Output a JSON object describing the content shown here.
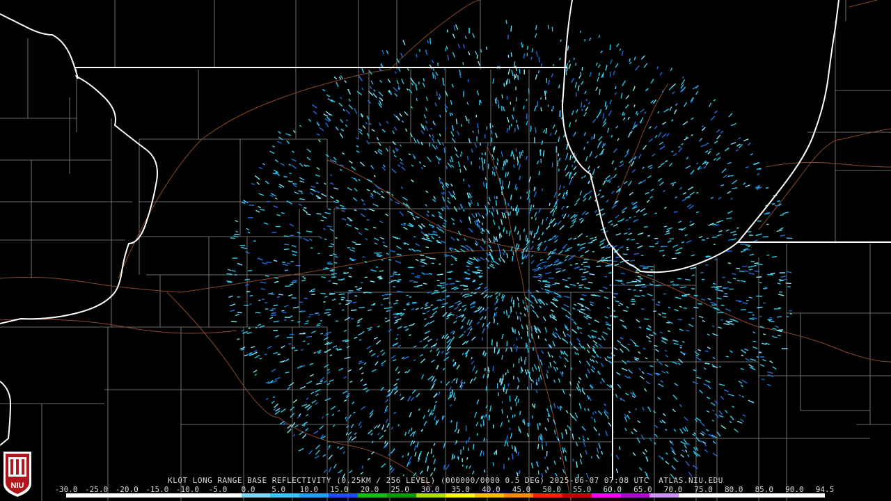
{
  "caption": "KLOT LONG RANGE BASE REFLECTIVITY (0.25KM / 256 LEVEL) (000000/0000 0.5 DEG) 2025-06-07 07:08 UTC  ATLAS.NIU.EDU",
  "logo_text": "NIU",
  "scale": {
    "labels": [
      "-30.0",
      "-25.0",
      "-20.0",
      "-15.0",
      "-10.0",
      "-5.0",
      "0.0",
      "5.0",
      "10.0",
      "15.0",
      "20.0",
      "25.0",
      "30.0",
      "35.0",
      "40.0",
      "45.0",
      "50.0",
      "55.0",
      "60.0",
      "65.0",
      "70.0",
      "75.0",
      "80.0",
      "85.0",
      "90.0",
      "94.5"
    ],
    "colors": [
      "#ffffff",
      "#ffffff",
      "#ffffff",
      "#ffffff",
      "#ffffff",
      "#ffffff",
      "#7fd8ff",
      "#34c6ff",
      "#1ea0ff",
      "#1f4dff",
      "#10c010",
      "#0a9a0a",
      "#b0e000",
      "#ffff00",
      "#ffc000",
      "#ff8a00",
      "#ff2000",
      "#c80000",
      "#ff00ff",
      "#b000d0",
      "#d090ff",
      "#ffffff",
      "#ffffff",
      "#ffffff",
      "#ffffff",
      "#ffffff"
    ]
  },
  "colors": {
    "background": "#000000",
    "state_border": "#ffffff",
    "county_line": "#8a8a8a",
    "highway": "#8a4a2a",
    "echo_primary": "#2fc7e6",
    "echo_light": "#7fe4f2",
    "echo_deep": "#1f6fd8"
  }
}
